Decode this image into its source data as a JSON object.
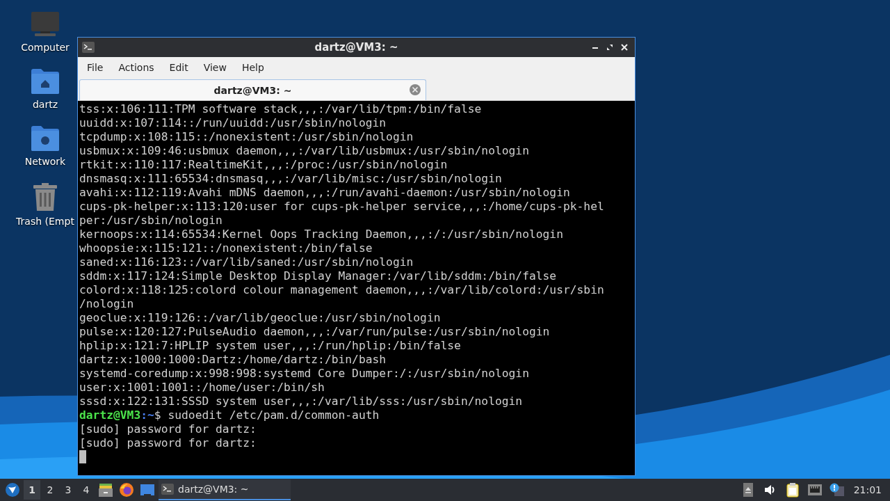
{
  "desktop_icons": [
    {
      "kind": "computer",
      "label": "Computer"
    },
    {
      "kind": "home",
      "label": "dartz"
    },
    {
      "kind": "network",
      "label": "Network"
    },
    {
      "kind": "trash",
      "label": "Trash (Empt"
    }
  ],
  "window": {
    "title": "dartz@VM3: ~",
    "active": true,
    "menu": [
      "File",
      "Actions",
      "Edit",
      "View",
      "Help"
    ],
    "tabs": [
      {
        "label": "dartz@VM3: ~",
        "selected": true
      }
    ],
    "terminal": {
      "lines": [
        {
          "kind": "output",
          "text": "tss:x:106:111:TPM software stack,,,:/var/lib/tpm:/bin/false"
        },
        {
          "kind": "output",
          "text": "uuidd:x:107:114::/run/uuidd:/usr/sbin/nologin"
        },
        {
          "kind": "output",
          "text": "tcpdump:x:108:115::/nonexistent:/usr/sbin/nologin"
        },
        {
          "kind": "output",
          "text": "usbmux:x:109:46:usbmux daemon,,,:/var/lib/usbmux:/usr/sbin/nologin"
        },
        {
          "kind": "output",
          "text": "rtkit:x:110:117:RealtimeKit,,,:/proc:/usr/sbin/nologin"
        },
        {
          "kind": "output",
          "text": "dnsmasq:x:111:65534:dnsmasq,,,:/var/lib/misc:/usr/sbin/nologin"
        },
        {
          "kind": "output",
          "text": "avahi:x:112:119:Avahi mDNS daemon,,,:/run/avahi-daemon:/usr/sbin/nologin"
        },
        {
          "kind": "output",
          "text": "cups-pk-helper:x:113:120:user for cups-pk-helper service,,,:/home/cups-pk-hel"
        },
        {
          "kind": "output",
          "text": "per:/usr/sbin/nologin"
        },
        {
          "kind": "output",
          "text": "kernoops:x:114:65534:Kernel Oops Tracking Daemon,,,:/:/usr/sbin/nologin"
        },
        {
          "kind": "output",
          "text": "whoopsie:x:115:121::/nonexistent:/bin/false"
        },
        {
          "kind": "output",
          "text": "saned:x:116:123::/var/lib/saned:/usr/sbin/nologin"
        },
        {
          "kind": "output",
          "text": "sddm:x:117:124:Simple Desktop Display Manager:/var/lib/sddm:/bin/false"
        },
        {
          "kind": "output",
          "text": "colord:x:118:125:colord colour management daemon,,,:/var/lib/colord:/usr/sbin"
        },
        {
          "kind": "output",
          "text": "/nologin"
        },
        {
          "kind": "output",
          "text": "geoclue:x:119:126::/var/lib/geoclue:/usr/sbin/nologin"
        },
        {
          "kind": "output",
          "text": "pulse:x:120:127:PulseAudio daemon,,,:/var/run/pulse:/usr/sbin/nologin"
        },
        {
          "kind": "output",
          "text": "hplip:x:121:7:HPLIP system user,,,:/run/hplip:/bin/false"
        },
        {
          "kind": "output",
          "text": "dartz:x:1000:1000:Dartz:/home/dartz:/bin/bash"
        },
        {
          "kind": "output",
          "text": "systemd-coredump:x:998:998:systemd Core Dumper:/:/usr/sbin/nologin"
        },
        {
          "kind": "output",
          "text": "user:x:1001:1001::/home/user:/bin/sh"
        },
        {
          "kind": "output",
          "text": "sssd:x:122:131:SSSD system user,,,:/var/lib/sss:/usr/sbin/nologin"
        },
        {
          "kind": "prompt",
          "user": "dartz@VM3",
          "path": ":~",
          "symbol": "$",
          "command": " sudoedit /etc/pam.d/common-auth"
        },
        {
          "kind": "output",
          "text": "[sudo] password for dartz:"
        },
        {
          "kind": "output",
          "text": "[sudo] password for dartz:"
        },
        {
          "kind": "cursor"
        }
      ]
    }
  },
  "taskbar": {
    "workspaces": [
      {
        "label": "1",
        "selected": true
      },
      {
        "label": "2",
        "selected": false
      },
      {
        "label": "3",
        "selected": false
      },
      {
        "label": "4",
        "selected": false
      }
    ],
    "launchers": [
      {
        "kind": "files"
      },
      {
        "kind": "browser"
      },
      {
        "kind": "desktop"
      }
    ],
    "tasks": [
      {
        "label": "dartz@VM3: ~",
        "selected": true
      }
    ],
    "tray": [
      {
        "kind": "eject"
      },
      {
        "kind": "volume"
      },
      {
        "kind": "clipboard"
      },
      {
        "kind": "network"
      },
      {
        "kind": "notification"
      }
    ],
    "clock": "21:01"
  }
}
